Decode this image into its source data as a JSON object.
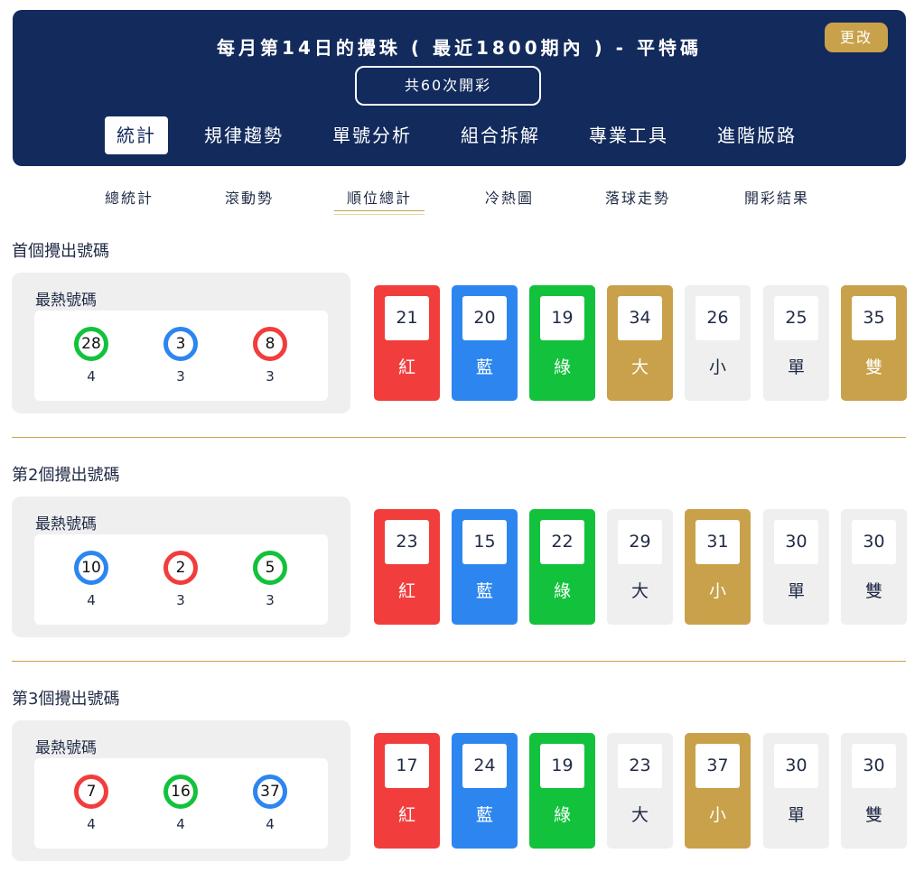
{
  "header": {
    "title": "每月第14日的攪珠 ( 最近1800期內 ) - 平特碼",
    "change_label": "更改",
    "count_label": "共60次開彩"
  },
  "main_tabs": [
    "統計",
    "規律趨勢",
    "單號分析",
    "組合拆解",
    "專業工具",
    "進階版路"
  ],
  "sub_tabs": [
    "總統計",
    "滾動勢",
    "順位總計",
    "冷熱圖",
    "落球走勢",
    "開彩結果"
  ],
  "colors": {
    "red": "#f23d3d",
    "blue": "#2d86f0",
    "green": "#12c23c",
    "gold": "#c8a14a",
    "navy": "#122a5c",
    "grey": "#efefef"
  },
  "sections": [
    {
      "title": "首個攪出號碼",
      "hot_label": "最熱號碼",
      "hot": [
        {
          "number": "28",
          "color": "green",
          "count": "4"
        },
        {
          "number": "3",
          "color": "blue",
          "count": "3"
        },
        {
          "number": "8",
          "color": "red",
          "count": "3"
        }
      ],
      "stats": [
        {
          "value": "21",
          "label": "紅",
          "bg": "red"
        },
        {
          "value": "20",
          "label": "藍",
          "bg": "blue"
        },
        {
          "value": "19",
          "label": "綠",
          "bg": "green"
        },
        {
          "value": "34",
          "label": "大",
          "bg": "gold"
        },
        {
          "value": "26",
          "label": "小",
          "bg": "grey"
        },
        {
          "value": "25",
          "label": "單",
          "bg": "grey"
        },
        {
          "value": "35",
          "label": "雙",
          "bg": "gold"
        }
      ]
    },
    {
      "title": "第2個攪出號碼",
      "hot_label": "最熱號碼",
      "hot": [
        {
          "number": "10",
          "color": "blue",
          "count": "4"
        },
        {
          "number": "2",
          "color": "red",
          "count": "3"
        },
        {
          "number": "5",
          "color": "green",
          "count": "3"
        }
      ],
      "stats": [
        {
          "value": "23",
          "label": "紅",
          "bg": "red"
        },
        {
          "value": "15",
          "label": "藍",
          "bg": "blue"
        },
        {
          "value": "22",
          "label": "綠",
          "bg": "green"
        },
        {
          "value": "29",
          "label": "大",
          "bg": "grey"
        },
        {
          "value": "31",
          "label": "小",
          "bg": "gold"
        },
        {
          "value": "30",
          "label": "單",
          "bg": "grey"
        },
        {
          "value": "30",
          "label": "雙",
          "bg": "grey"
        }
      ]
    },
    {
      "title": "第3個攪出號碼",
      "hot_label": "最熱號碼",
      "hot": [
        {
          "number": "7",
          "color": "red",
          "count": "4"
        },
        {
          "number": "16",
          "color": "green",
          "count": "4"
        },
        {
          "number": "37",
          "color": "blue",
          "count": "4"
        }
      ],
      "stats": [
        {
          "value": "17",
          "label": "紅",
          "bg": "red"
        },
        {
          "value": "24",
          "label": "藍",
          "bg": "blue"
        },
        {
          "value": "19",
          "label": "綠",
          "bg": "green"
        },
        {
          "value": "23",
          "label": "大",
          "bg": "grey"
        },
        {
          "value": "37",
          "label": "小",
          "bg": "gold"
        },
        {
          "value": "30",
          "label": "單",
          "bg": "grey"
        },
        {
          "value": "30",
          "label": "雙",
          "bg": "grey"
        }
      ]
    }
  ]
}
